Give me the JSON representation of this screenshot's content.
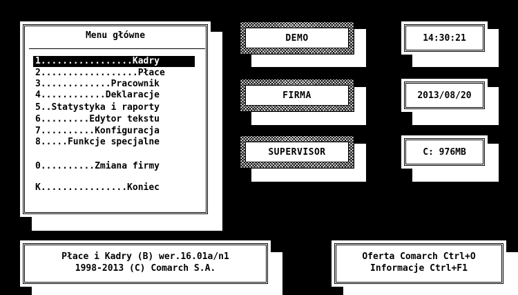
{
  "menu": {
    "title": "Menu główne",
    "items": [
      {
        "text": "1.................Kadry",
        "selected": true
      },
      {
        "text": "2..................Płace",
        "selected": false
      },
      {
        "text": "3.............Pracownik",
        "selected": false
      },
      {
        "text": "4............Deklaracje",
        "selected": false
      },
      {
        "text": "5..Statystyka i raporty",
        "selected": false
      },
      {
        "text": "6.........Edytor tekstu",
        "selected": false
      },
      {
        "text": "7..........Konfiguracja",
        "selected": false
      },
      {
        "text": "8.....Funkcje specjalne",
        "selected": false
      },
      {
        "text": "0..........Zmiana firmy",
        "selected": false
      },
      {
        "text": "K................Koniec",
        "selected": false
      }
    ]
  },
  "buttons": {
    "demo": "DEMO",
    "firma": "FIRMA",
    "supervisor": "SUPERVISOR"
  },
  "status": {
    "time": "14:30:21",
    "date": "2013/08/20",
    "disk": "C: 976MB"
  },
  "footer": {
    "version_line1": "Płace i Kadry (B) wer.16.01a/n1",
    "version_line2": "1998-2013 (C) Comarch S.A.",
    "help_line1": "Oferta Comarch Ctrl+O",
    "help_line2": "Informacje Ctrl+F1"
  },
  "colors": {
    "background": "#000000",
    "panel": "#ffffff",
    "selection": "#000000"
  }
}
